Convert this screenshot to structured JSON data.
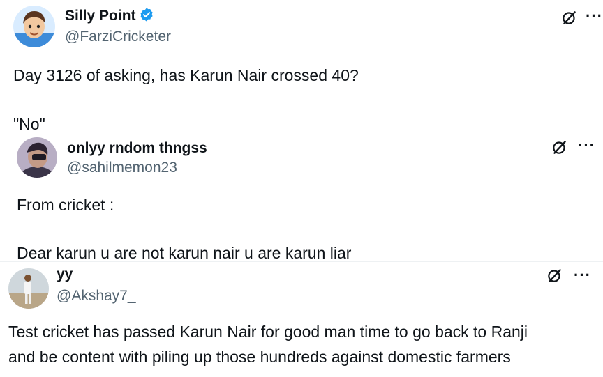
{
  "tweets": [
    {
      "display_name": "Silly Point",
      "verified": true,
      "handle": "@FarziCricketer",
      "lines": [
        "Day 3126 of asking, has Karun Nair crossed 40?",
        "\"No\""
      ],
      "avatar_icon": "cartoon-avatar"
    },
    {
      "display_name": "onlyy rndom thngss",
      "verified": false,
      "handle": "@sahilmemon23",
      "lines": [
        "From cricket :",
        "Dear karun  u are not karun nair u are karun liar"
      ],
      "avatar_icon": "photo-avatar"
    },
    {
      "display_name": "yy",
      "verified": false,
      "handle": "@Akshay7_",
      "lines": [
        "Test cricket has passed Karun Nair for good man time to go back to Ranji",
        "and be content with piling up those hundreds against domestic farmers"
      ],
      "avatar_icon": "photo-avatar"
    }
  ],
  "actions": {
    "more_label": "···",
    "grok_icon": "grok-icon"
  },
  "colors": {
    "text": "#0f1419",
    "secondary": "#536471",
    "verified": "#1d9bf0"
  }
}
